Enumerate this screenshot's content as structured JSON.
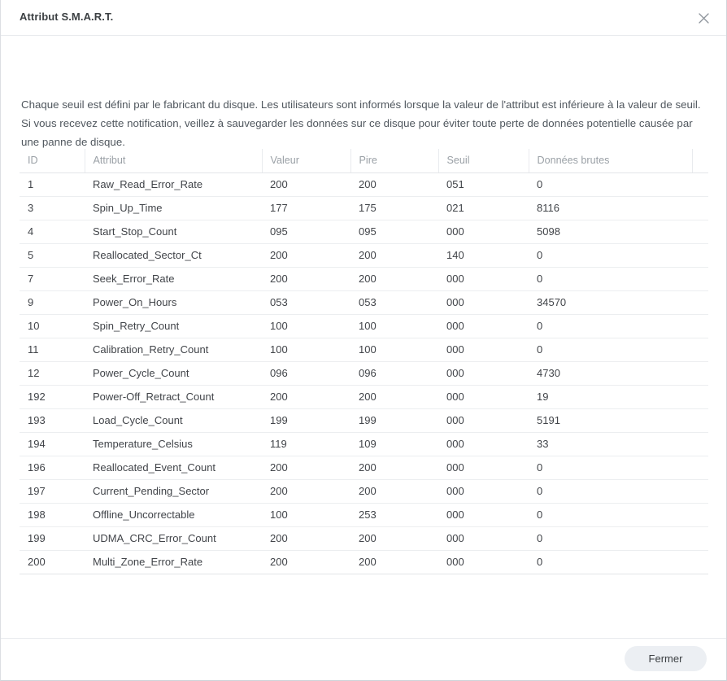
{
  "window": {
    "title": "Attribut S.M.A.R.T.",
    "close_icon": "close-icon"
  },
  "description": "Chaque seuil est défini par le fabricant du disque. Les utilisateurs sont informés lorsque la valeur de l'attribut est inférieure à la valeur de seuil. Si vous recevez cette notification, veillez à sauvegarder les données sur ce disque pour éviter toute perte de données potentielle causée par une panne de disque.",
  "table": {
    "columns": [
      "ID",
      "Attribut",
      "Valeur",
      "Pire",
      "Seuil",
      "Données brutes",
      ""
    ],
    "rows": [
      {
        "id": "1",
        "attribute": "Raw_Read_Error_Rate",
        "value": "200",
        "worst": "200",
        "threshold": "051",
        "raw": "0"
      },
      {
        "id": "3",
        "attribute": "Spin_Up_Time",
        "value": "177",
        "worst": "175",
        "threshold": "021",
        "raw": "8116"
      },
      {
        "id": "4",
        "attribute": "Start_Stop_Count",
        "value": "095",
        "worst": "095",
        "threshold": "000",
        "raw": "5098"
      },
      {
        "id": "5",
        "attribute": "Reallocated_Sector_Ct",
        "value": "200",
        "worst": "200",
        "threshold": "140",
        "raw": "0"
      },
      {
        "id": "7",
        "attribute": "Seek_Error_Rate",
        "value": "200",
        "worst": "200",
        "threshold": "000",
        "raw": "0"
      },
      {
        "id": "9",
        "attribute": "Power_On_Hours",
        "value": "053",
        "worst": "053",
        "threshold": "000",
        "raw": "34570"
      },
      {
        "id": "10",
        "attribute": "Spin_Retry_Count",
        "value": "100",
        "worst": "100",
        "threshold": "000",
        "raw": "0"
      },
      {
        "id": "11",
        "attribute": "Calibration_Retry_Count",
        "value": "100",
        "worst": "100",
        "threshold": "000",
        "raw": "0"
      },
      {
        "id": "12",
        "attribute": "Power_Cycle_Count",
        "value": "096",
        "worst": "096",
        "threshold": "000",
        "raw": "4730"
      },
      {
        "id": "192",
        "attribute": "Power-Off_Retract_Count",
        "value": "200",
        "worst": "200",
        "threshold": "000",
        "raw": "19"
      },
      {
        "id": "193",
        "attribute": "Load_Cycle_Count",
        "value": "199",
        "worst": "199",
        "threshold": "000",
        "raw": "5191"
      },
      {
        "id": "194",
        "attribute": "Temperature_Celsius",
        "value": "119",
        "worst": "109",
        "threshold": "000",
        "raw": "33"
      },
      {
        "id": "196",
        "attribute": "Reallocated_Event_Count",
        "value": "200",
        "worst": "200",
        "threshold": "000",
        "raw": "0"
      },
      {
        "id": "197",
        "attribute": "Current_Pending_Sector",
        "value": "200",
        "worst": "200",
        "threshold": "000",
        "raw": "0"
      },
      {
        "id": "198",
        "attribute": "Offline_Uncorrectable",
        "value": "100",
        "worst": "253",
        "threshold": "000",
        "raw": "0"
      },
      {
        "id": "199",
        "attribute": "UDMA_CRC_Error_Count",
        "value": "200",
        "worst": "200",
        "threshold": "000",
        "raw": "0"
      },
      {
        "id": "200",
        "attribute": "Multi_Zone_Error_Rate",
        "value": "200",
        "worst": "200",
        "threshold": "000",
        "raw": "0"
      }
    ]
  },
  "footer": {
    "close_label": "Fermer"
  },
  "colors": {
    "title_text": "#3c4043",
    "body_text": "#50575e",
    "header_text": "#9aa0a6",
    "cell_text": "#414449",
    "border": "#e8eaed",
    "button_bg": "#eceff3"
  }
}
